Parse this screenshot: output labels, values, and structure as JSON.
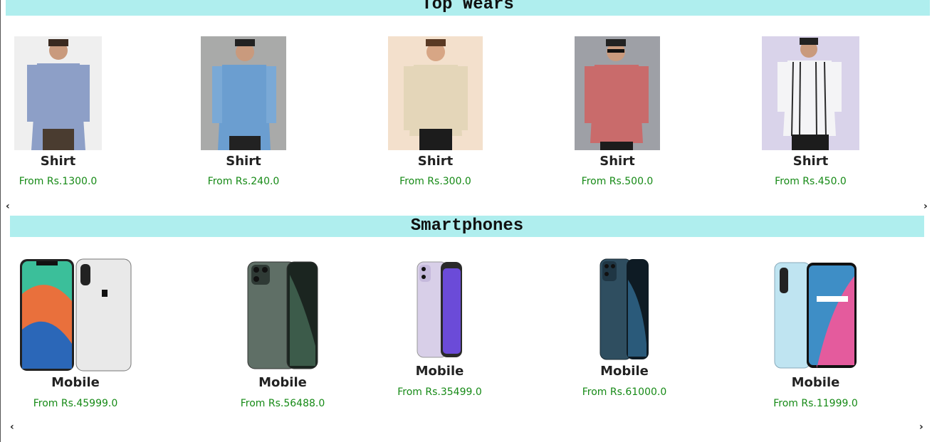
{
  "sections": {
    "top_wears": {
      "title": "Top Wears",
      "items": [
        {
          "name": "Shirt",
          "price": "From Rs.1300.0",
          "bg": "#efefef",
          "shirt": "#8d9fc7"
        },
        {
          "name": "Shirt",
          "price": "From Rs.240.0",
          "bg": "#a9aaa9",
          "shirt": "#6b9ed0"
        },
        {
          "name": "Shirt",
          "price": "From Rs.300.0",
          "bg": "#f3e0cc",
          "shirt": "#e4d6b9"
        },
        {
          "name": "Shirt",
          "price": "From Rs.500.0",
          "bg": "#9ea0a6",
          "shirt": "#c96b6b"
        },
        {
          "name": "Shirt",
          "price": "From Rs.450.0",
          "bg": "#d9d3ea",
          "shirt": "#f4f4f6"
        }
      ]
    },
    "smartphones": {
      "title": "Smartphones",
      "items": [
        {
          "name": "Mobile",
          "price": "From Rs.45999.0",
          "body": "#e9e9e9"
        },
        {
          "name": "Mobile",
          "price": "From Rs.56488.0",
          "body": "#5f6f66"
        },
        {
          "name": "Mobile",
          "price": "From Rs.35499.0",
          "body": "#d8cfe8"
        },
        {
          "name": "Mobile",
          "price": "From Rs.61000.0",
          "body": "#2f4e60"
        },
        {
          "name": "Mobile",
          "price": "From Rs.11999.0",
          "body": "#bfe4f1"
        }
      ]
    }
  },
  "arrows": {
    "prev": "‹",
    "next": "›"
  }
}
